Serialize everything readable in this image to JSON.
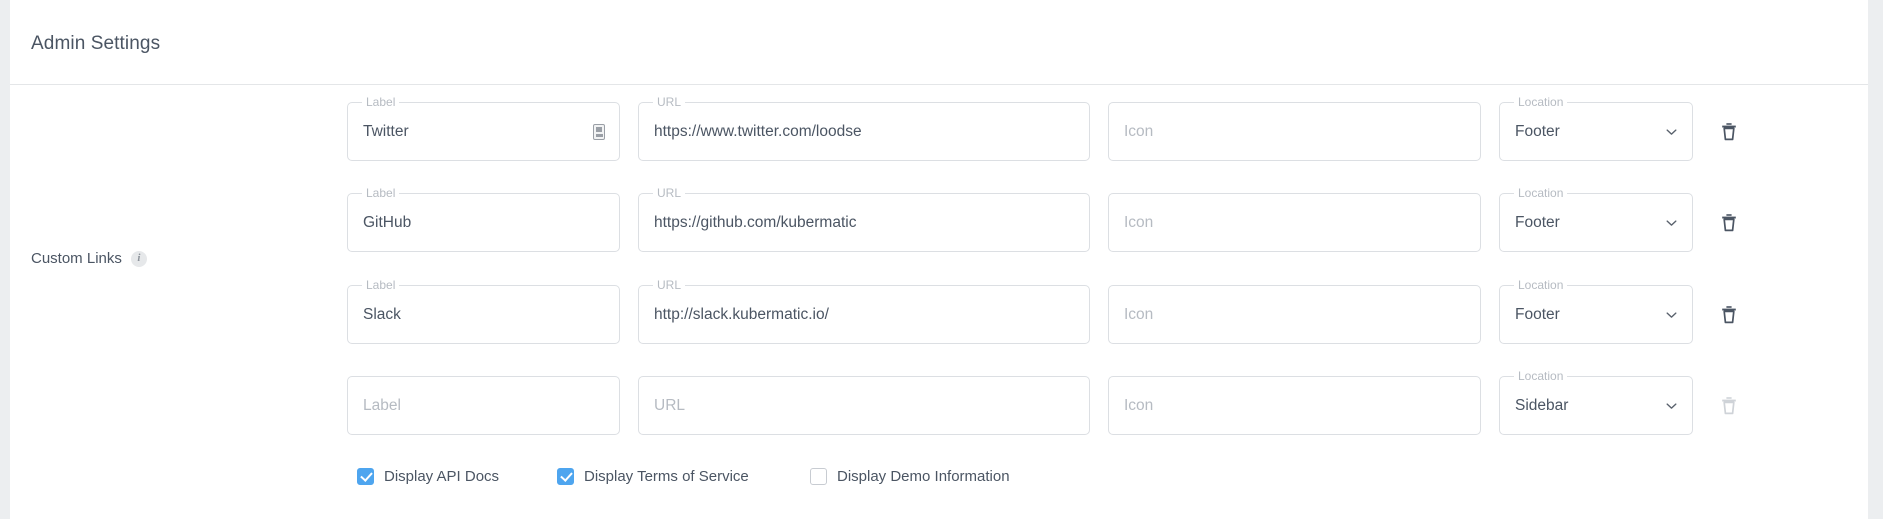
{
  "header": {
    "title": "Admin Settings"
  },
  "section": {
    "label": "Custom Links",
    "info_icon": "info-icon"
  },
  "colors": {
    "accent": "#4ea5ef",
    "text": "#4b5563",
    "muted": "#b6bbc2",
    "border": "#dcdfe3",
    "page_bg": "#eceef0",
    "card_bg": "#ffffff"
  },
  "field_labels": {
    "label": "Label",
    "url": "URL",
    "icon": "Icon",
    "location": "Location"
  },
  "placeholders": {
    "label": "Label",
    "url": "URL",
    "icon": "Icon"
  },
  "icons": {
    "delete": "trash-icon",
    "dropdown": "chevron-down-icon",
    "glyph": "tofu-glyph-icon"
  },
  "location_options": [
    "Footer",
    "Sidebar"
  ],
  "custom_links": [
    {
      "label": "Twitter",
      "url": "https://www.twitter.com/loodse",
      "icon": "",
      "location": "Footer",
      "has_glyph": true,
      "delete_enabled": true
    },
    {
      "label": "GitHub",
      "url": "https://github.com/kubermatic",
      "icon": "",
      "location": "Footer",
      "has_glyph": false,
      "delete_enabled": true
    },
    {
      "label": "Slack",
      "url": "http://slack.kubermatic.io/",
      "icon": "",
      "location": "Footer",
      "has_glyph": false,
      "delete_enabled": true
    },
    {
      "label": "",
      "url": "",
      "icon": "",
      "location": "Sidebar",
      "has_glyph": false,
      "delete_enabled": false
    }
  ],
  "checkboxes": [
    {
      "label": "Display API Docs",
      "checked": true
    },
    {
      "label": "Display Terms of Service",
      "checked": true
    },
    {
      "label": "Display Demo Information",
      "checked": false
    }
  ]
}
